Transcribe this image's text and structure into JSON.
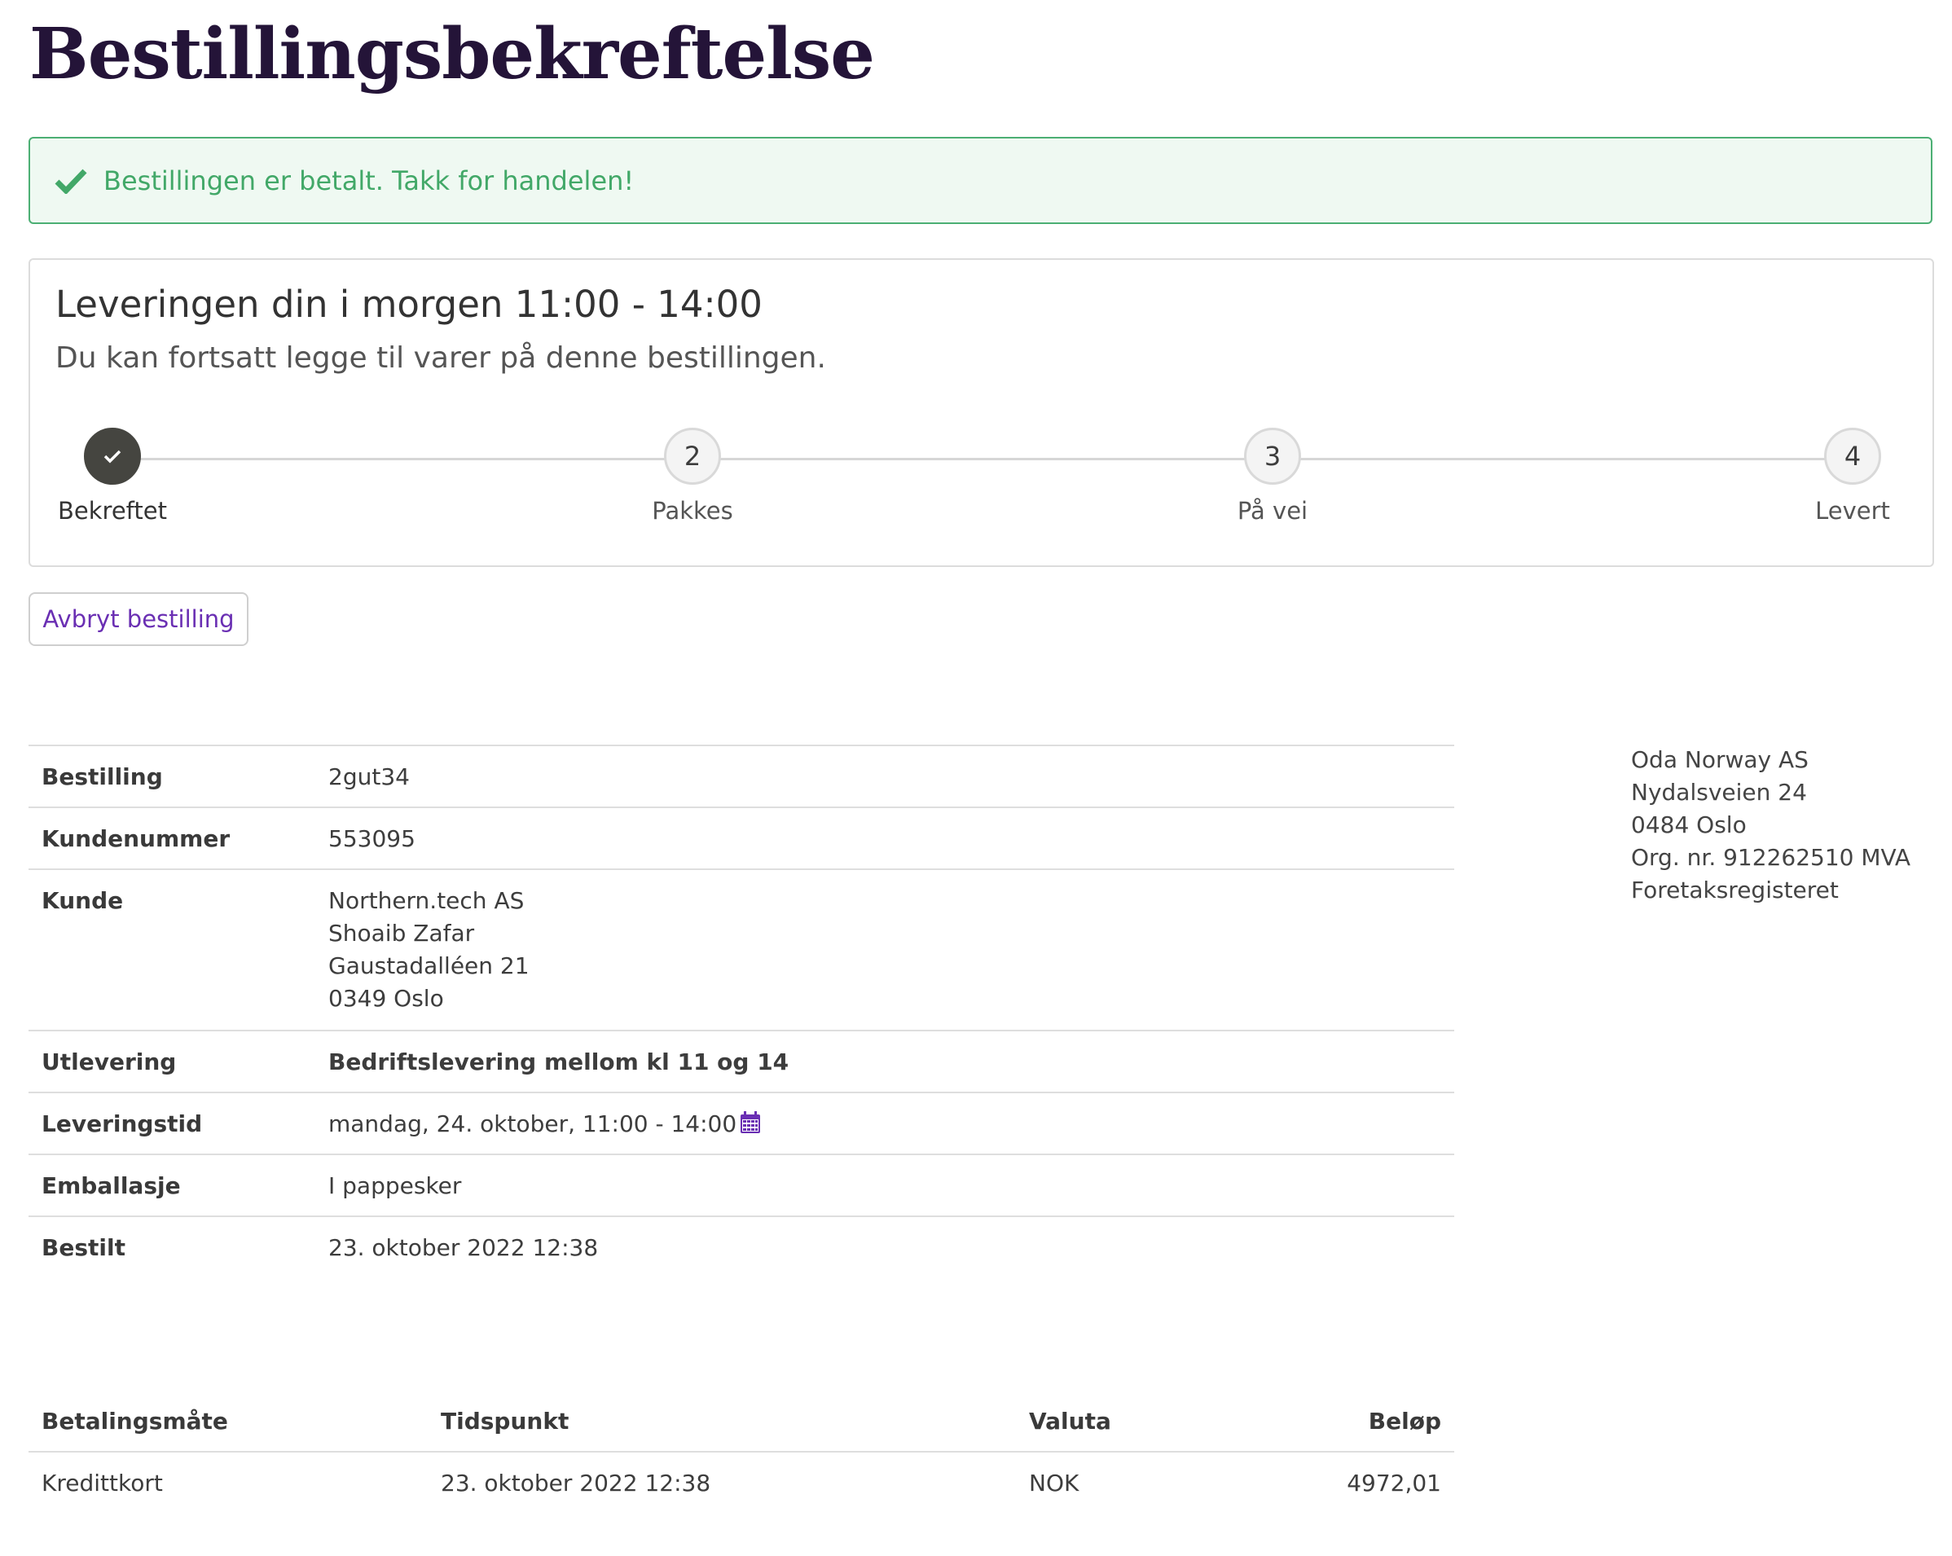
{
  "page": {
    "title": "Bestillingsbekreftelse"
  },
  "alert": {
    "message": "Bestillingen er betalt. Takk for handelen!",
    "icon": "checkmark-icon",
    "color": "#42a868"
  },
  "delivery": {
    "heading": "Leveringen din i morgen 11:00 - 14:00",
    "subheading": "Du kan fortsatt legge til varer på denne bestillingen.",
    "steps": [
      {
        "number": "1",
        "label": "Bekreftet",
        "done": true,
        "icon": "check-icon"
      },
      {
        "number": "2",
        "label": "Pakkes",
        "done": false
      },
      {
        "number": "3",
        "label": "På vei",
        "done": false
      },
      {
        "number": "4",
        "label": "Levert",
        "done": false
      }
    ]
  },
  "actions": {
    "cancel_label": "Avbryt bestilling"
  },
  "order_details": {
    "order": {
      "label": "Bestilling",
      "value": "2gut34"
    },
    "customer_number": {
      "label": "Kundenummer",
      "value": "553095"
    },
    "customer": {
      "label": "Kunde",
      "lines": [
        "Northern.tech AS",
        "Shoaib Zafar",
        "Gaustadalléen 21",
        "0349 Oslo"
      ]
    },
    "delivery_method": {
      "label": "Utlevering",
      "value": "Bedriftslevering mellom kl 11 og 14"
    },
    "delivery_time": {
      "label": "Leveringstid",
      "value": "mandag, 24. oktober, 11:00 - 14:00",
      "icon": "calendar-icon"
    },
    "packaging": {
      "label": "Emballasje",
      "value": "I pappesker"
    },
    "ordered": {
      "label": "Bestilt",
      "value": "23. oktober 2022 12:38"
    }
  },
  "company": {
    "lines": [
      "Oda Norway AS",
      "Nydalsveien 24",
      "0484 Oslo",
      "Org. nr. 912262510 MVA",
      "Foretaksregisteret"
    ]
  },
  "payment": {
    "headers": {
      "method": "Betalingsmåte",
      "time": "Tidspunkt",
      "currency": "Valuta",
      "amount": "Beløp"
    },
    "rows": [
      {
        "method": "Kredittkort",
        "time": "23. oktober 2022 12:38",
        "currency": "NOK",
        "amount": "4972,01"
      }
    ]
  },
  "colors": {
    "title": "#241438",
    "accent": "#6a2fb3",
    "success": "#42a868",
    "step_done": "#454540"
  }
}
